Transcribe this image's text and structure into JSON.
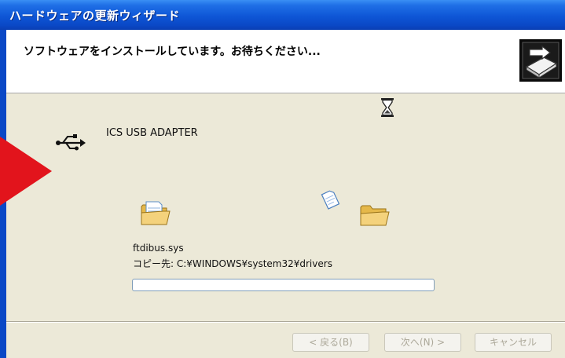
{
  "window": {
    "title": "ハードウェアの更新ウィザード"
  },
  "header": {
    "heading": "ソフトウェアをインストールしています。お待ちください...",
    "icon": "hardware-install-icon"
  },
  "device": {
    "name": "ICS USB ADAPTER",
    "icon": "usb-icon"
  },
  "copy": {
    "file_name": "ftdibus.sys",
    "destination": "コピー先: C:¥WINDOWS¥system32¥drivers",
    "progress_fraction": 0.0
  },
  "buttons": {
    "back": "< 戻る(B)",
    "next": "次へ(N) >",
    "cancel": "キャンセル"
  },
  "colors": {
    "titlebar": "#0a48c6",
    "dialog_bg": "#ece9d8",
    "pointer_arrow": "#e2141c"
  }
}
